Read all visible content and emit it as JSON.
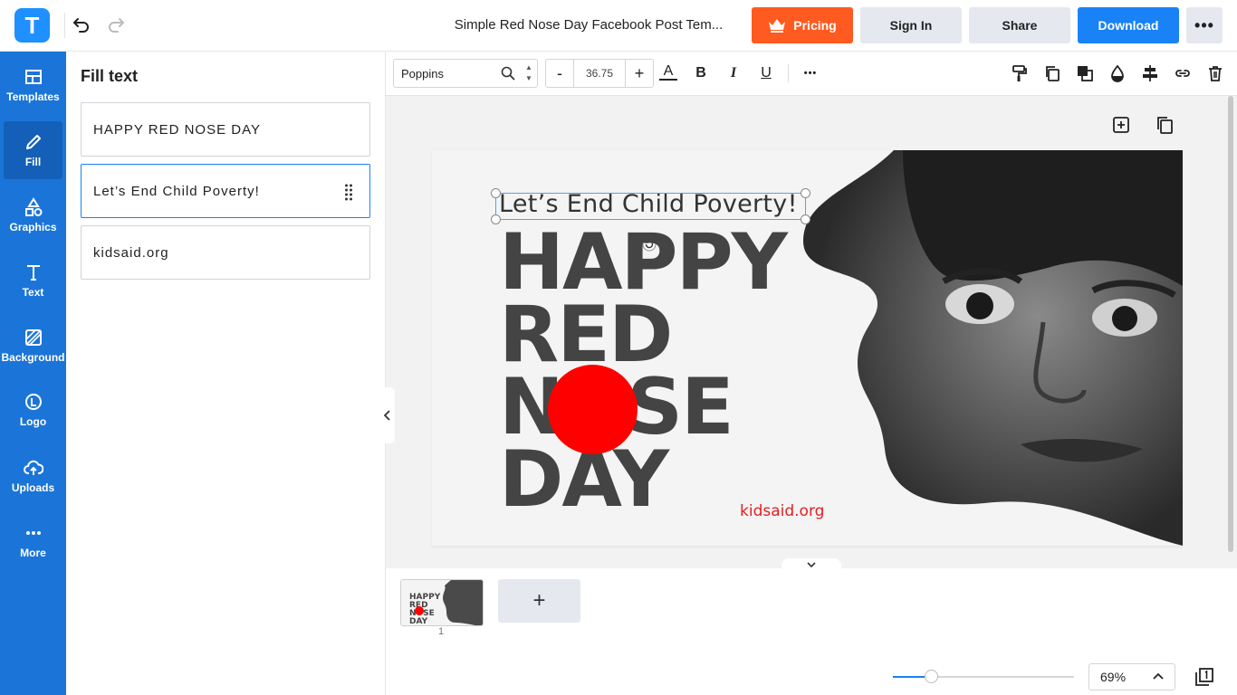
{
  "header": {
    "logo_letter": "T",
    "doc_title": "Simple Red Nose Day Facebook Post Tem...",
    "pricing_label": "Pricing",
    "signin_label": "Sign In",
    "share_label": "Share",
    "download_label": "Download",
    "more_label": "•••"
  },
  "sidebar": {
    "items": [
      {
        "label": "Templates",
        "icon": "templates-icon"
      },
      {
        "label": "Fill",
        "icon": "pencil-icon"
      },
      {
        "label": "Graphics",
        "icon": "shapes-icon"
      },
      {
        "label": "Text",
        "icon": "text-icon"
      },
      {
        "label": "Background",
        "icon": "background-icon"
      },
      {
        "label": "Logo",
        "icon": "logo-icon"
      },
      {
        "label": "Uploads",
        "icon": "upload-icon"
      },
      {
        "label": "More",
        "icon": "more-icon"
      }
    ],
    "active": "Fill"
  },
  "panel": {
    "title": "Fill text",
    "fields": [
      {
        "value": "HAPPY RED NOSE DAY"
      },
      {
        "value": "Let’s End Child Poverty!"
      },
      {
        "value": "kidsaid.org"
      }
    ]
  },
  "toolbar": {
    "font_name": "Poppins",
    "font_size": "36.75",
    "minus_label": "-",
    "plus_label": "+",
    "color_label": "A",
    "bold_label": "B",
    "italic_label": "I",
    "underline_label": "U",
    "more_label": "•••"
  },
  "design": {
    "subtitle": "Let’s End Child Poverty!",
    "headline": [
      "HAPPY",
      "RED",
      "NOSE",
      "DAY"
    ],
    "url": "kidsaid.org",
    "nose_color": "#ff0000",
    "url_color": "#e52020"
  },
  "pages": {
    "thumb_number": "1",
    "add_label": "+"
  },
  "zoom": {
    "value": "69%",
    "slider_fraction": 0.21
  }
}
